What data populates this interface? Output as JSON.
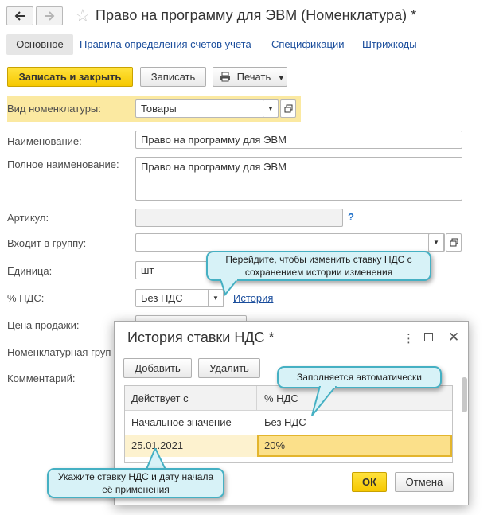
{
  "window": {
    "title": "Право на программу для ЭВМ (Номенклатура) *"
  },
  "nav": {
    "back_icon": "arrow-left-icon",
    "forward_icon": "arrow-right-icon",
    "favorite_icon": "star-icon"
  },
  "tabs": [
    {
      "label": "Основное",
      "active": true
    },
    {
      "label": "Правила определения счетов учета"
    },
    {
      "label": "Спецификации"
    },
    {
      "label": "Штрихкоды"
    }
  ],
  "toolbar": {
    "save_close_label": "Записать и закрыть",
    "save_label": "Записать",
    "print_label": "Печать"
  },
  "form": {
    "nomenclature_type": {
      "label": "Вид номенклатуры:",
      "value": "Товары"
    },
    "name": {
      "label": "Наименование:",
      "value": "Право на программу для ЭВМ"
    },
    "full_name": {
      "label": "Полное наименование:",
      "value": "Право на программу для ЭВМ"
    },
    "article": {
      "label": "Артикул:",
      "value": "",
      "help": "?"
    },
    "group": {
      "label": "Входит в группу:",
      "value": ""
    },
    "unit": {
      "label": "Единица:",
      "value": "шт"
    },
    "vat": {
      "label": "% НДС:",
      "value": "Без НДС",
      "history_link": "История"
    },
    "price": {
      "label": "Цена продажи:"
    },
    "nomenclature_group": {
      "label": "Номенклатурная груп"
    },
    "comment": {
      "label": "Комментарий:"
    }
  },
  "dialog": {
    "title": "История ставки НДС *",
    "add_label": "Добавить",
    "delete_label": "Удалить",
    "columns": [
      "Действует с",
      "% НДС"
    ],
    "rows": [
      {
        "date": "Начальное значение",
        "vat": "Без НДС"
      },
      {
        "date": "25.01.2021",
        "vat": "20%"
      }
    ],
    "ok_label": "ОК",
    "cancel_label": "Отмена"
  },
  "callouts": {
    "history": "Перейдите, чтобы изменить ставку НДС с сохранением истории изменения",
    "auto": "Заполняется автоматически",
    "specify": "Укажите ставку НДС и дату начала её применения"
  },
  "colors": {
    "accent_yellow": "#f6c800",
    "link_blue": "#1a4d9c",
    "callout_bg": "#d7f2f7",
    "callout_border": "#45b0c3"
  }
}
